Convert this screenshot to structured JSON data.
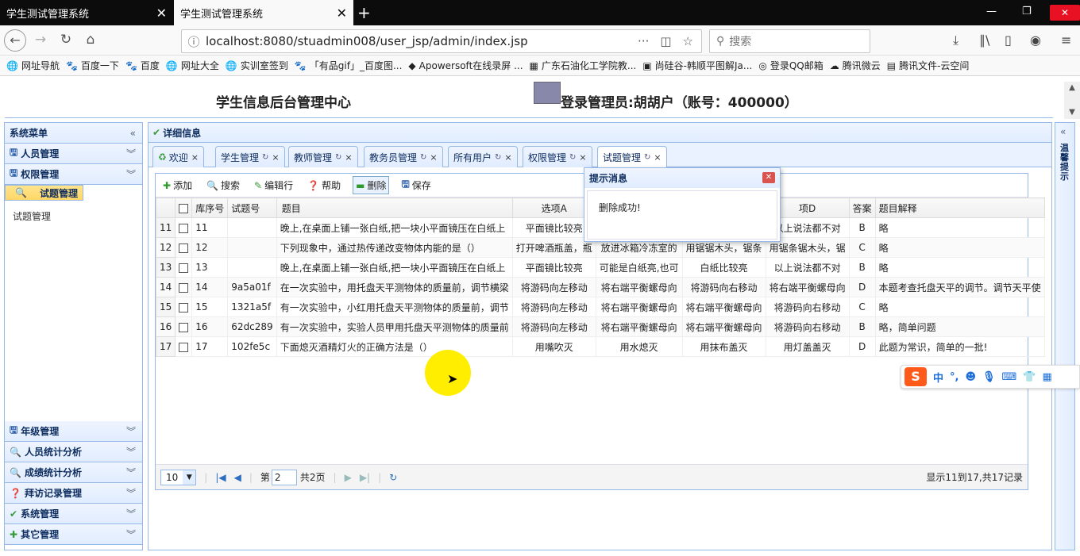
{
  "browser": {
    "tabs": [
      {
        "title": "学生测试管理系统"
      },
      {
        "title": "学生测试管理系统"
      }
    ],
    "url": "localhost:8080/stuadmin008/user_jsp/admin/index.jsp",
    "search_placeholder": "搜索",
    "bookmarks": [
      "网址导航",
      "百度一下",
      "百度",
      "网址大全",
      "实训室签到",
      "「有品gif」_百度图...",
      "Apowersoft在线录屏 ...",
      "广东石油化工学院教...",
      "尚硅谷-韩顺平图解Ja...",
      "登录QQ邮箱",
      "腾讯微云",
      "腾讯文件-云空间"
    ]
  },
  "header": {
    "title": "学生信息后台管理中心",
    "admin": "登录管理员:胡胡户（账号：400000）"
  },
  "sidebar": {
    "title": "系统菜单",
    "sections": [
      {
        "label": "人员管理",
        "icon": "save-icon"
      },
      {
        "label": "权限管理",
        "icon": "save-icon"
      },
      {
        "label": "试题管理",
        "icon": "search-icon",
        "expanded": true,
        "items": [
          "试题管理"
        ]
      }
    ],
    "bottom_sections": [
      {
        "label": "年级管理",
        "icon": "save-icon"
      },
      {
        "label": "人员统计分析",
        "icon": "search-icon"
      },
      {
        "label": "成绩统计分析",
        "icon": "search-icon"
      },
      {
        "label": "拜访记录管理",
        "icon": "help-icon"
      },
      {
        "label": "系统管理",
        "icon": "check-icon"
      },
      {
        "label": "其它管理",
        "icon": "plus-icon"
      }
    ]
  },
  "main": {
    "title": "详细信息",
    "tabs": [
      "欢迎",
      "学生管理",
      "教师管理",
      "教务员管理",
      "所有用户",
      "权限管理",
      "试题管理"
    ],
    "active_tab": "试题管理",
    "toolbar": [
      "添加",
      "搜索",
      "编辑行",
      "帮助",
      "删除",
      "保存"
    ],
    "columns": [
      "库序号",
      "试题号",
      "题目",
      "选项A",
      "",
      "",
      "项D",
      "答案",
      "题目解释"
    ],
    "rows": [
      {
        "rn": "11",
        "id": "11",
        "qid": "",
        "q": "晚上,在桌面上铺一张白纸,把一块小平面镜压在白纸上",
        "a": "平面镜比较亮",
        "b": "",
        "c": "",
        "d": "以上说法都不对",
        "ans": "B",
        "exp": "略"
      },
      {
        "rn": "12",
        "id": "12",
        "qid": "",
        "q": "下列现象中，通过热传递改变物体内能的是（）",
        "a": "打开啤酒瓶盖，瓶",
        "b": "放进冰箱冷冻室的",
        "c": "用锯锯木头，锯条",
        "d": "用锯条锯木头，锯",
        "ans": "C",
        "exp": "略"
      },
      {
        "rn": "13",
        "id": "13",
        "qid": "",
        "q": "晚上,在桌面上铺一张白纸,把一块小平面镜压在白纸上",
        "a": "平面镜比较亮",
        "b": "可能是白纸亮,也可",
        "c": "白纸比较亮",
        "d": "以上说法都不对",
        "ans": "B",
        "exp": "略"
      },
      {
        "rn": "14",
        "id": "14",
        "qid": "9a5a01f",
        "q": "在一次实验中，用托盘天平测物体的质量前，调节横梁",
        "a": "将游码向左移动",
        "b": "将右端平衡螺母向",
        "c": "将游码向右移动",
        "d": "将右端平衡螺母向",
        "ans": "D",
        "exp": "本题考查托盘天平的调节。调节天平使"
      },
      {
        "rn": "15",
        "id": "15",
        "qid": "1321a5f",
        "q": "有一次实验中，小红用托盘天平测物体的质量前，调节",
        "a": "将游码向左移动",
        "b": "将右端平衡螺母向",
        "c": "将右端平衡螺母向",
        "d": "将游码向右移动",
        "ans": "C",
        "exp": "略"
      },
      {
        "rn": "16",
        "id": "16",
        "qid": "62dc289",
        "q": "有一次实验中，实验人员甲用托盘天平测物体的质量前",
        "a": "将游码向左移动",
        "b": "将右端平衡螺母向",
        "c": "将右端平衡螺母向",
        "d": "将游码向右移动",
        "ans": "B",
        "exp": "略，简单问题"
      },
      {
        "rn": "17",
        "id": "17",
        "qid": "102fe5c",
        "q": "下面熄灭酒精灯火的正确方法是（）",
        "a": "用嘴吹灭",
        "b": "用水熄灭",
        "c": "用抹布盖灭",
        "d": "用灯盖盖灭",
        "ans": "D",
        "exp": "此题为常识，简单的一批!"
      }
    ],
    "pager": {
      "page_size": "10",
      "page_prefix": "第",
      "page": "2",
      "page_total": "共2页",
      "info": "显示11到17,共17记录"
    }
  },
  "dialog": {
    "title": "提示消息",
    "message": "删除成功!"
  },
  "right_panel": {
    "title": "温馨提示"
  },
  "ime": {
    "mode": "中",
    "punct": "°,"
  }
}
